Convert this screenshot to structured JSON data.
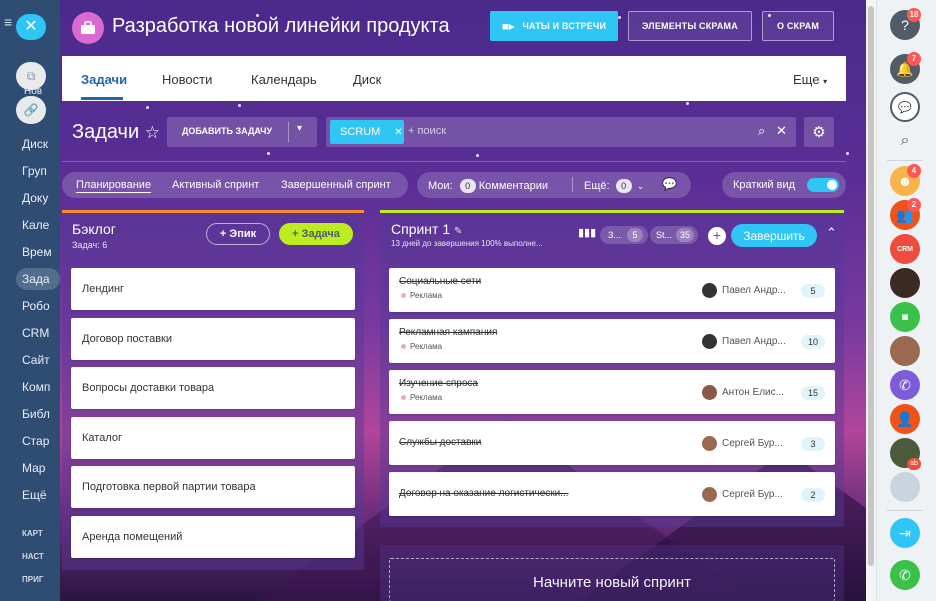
{
  "left_sidebar": {
    "items": [
      "Диск",
      "Груп",
      "Доку",
      "Кале",
      "Врем",
      "Зада",
      "Робо",
      "CRM",
      "Сайт",
      "Комп",
      "Библ",
      "Стар",
      "Мар",
      "Ещё"
    ],
    "lower": [
      "КАРТ",
      "НАСТ",
      "ПРИГ"
    ],
    "top_labels": [
      "Нов"
    ]
  },
  "header": {
    "title": "Разработка новой линейки продукта",
    "chats_button": "ЧАТЫ И ВСТРЕЧИ",
    "scrum_elements_button": "ЭЛЕМЕНТЫ СКРАМА",
    "about_scrum_button": "О СКРАМ"
  },
  "tabs": {
    "items": [
      "Задачи",
      "Новости",
      "Календарь",
      "Диск"
    ],
    "more": "Еще"
  },
  "toolbar": {
    "title": "Задачи",
    "add_task": "ДОБАВИТЬ ЗАДАЧУ",
    "search_chip": "SCRUM",
    "search_placeholder": "+ поиск"
  },
  "filters": {
    "planning": "Планирование",
    "active_sprint": "Активный спринт",
    "finished_sprint": "Завершенный спринт",
    "mine_label": "Мои:",
    "mine_count": "0",
    "comments": "Комментарии",
    "more_label": "Ещё:",
    "more_count": "0",
    "compact_view": "Краткий вид"
  },
  "backlog": {
    "title": "Бэклог",
    "count": "Задач: 6",
    "epic_button": "+ Эпик",
    "task_button": "+ Задача",
    "items": [
      "Лендинг",
      "Договор поставки",
      "Вопросы доставки товара",
      "Каталог",
      "Подготовка первой партии товара",
      "Аренда помещений"
    ]
  },
  "sprint": {
    "title": "Спринт 1",
    "subtitle": "13 дней до завершения 100% выполне...",
    "stat1_label": "З...",
    "stat1_value": "5",
    "stat2_label": "St...",
    "stat2_value": "35",
    "finish_button": "Завершить",
    "items": [
      {
        "title": "Социальные сети",
        "tag": "Реклама",
        "assignee": "Павел Андр...",
        "points": "5"
      },
      {
        "title": "Рекламная кампания",
        "tag": "Реклама",
        "assignee": "Павел Андр...",
        "points": "10"
      },
      {
        "title": "Изучение спроса",
        "tag": "Реклама",
        "assignee": "Антон Елис...",
        "points": "15"
      },
      {
        "title": "Службы доставки",
        "tag": "",
        "assignee": "Сергей Бур...",
        "points": "3"
      },
      {
        "title": "Договор на оказание логистически...",
        "tag": "",
        "assignee": "Сергей Бур...",
        "points": "2"
      }
    ],
    "new_sprint": "Начните новый спринт"
  },
  "right_sidebar": {
    "badges": [
      "18",
      "7",
      "4",
      "2"
    ],
    "crm_label": "CRM",
    "avatar_badge": "ab"
  },
  "colors": {
    "accent": "#2fc6f6",
    "lime": "#bbed21",
    "brand_blue": "#2067b0",
    "badge_red": "#ff5752"
  }
}
